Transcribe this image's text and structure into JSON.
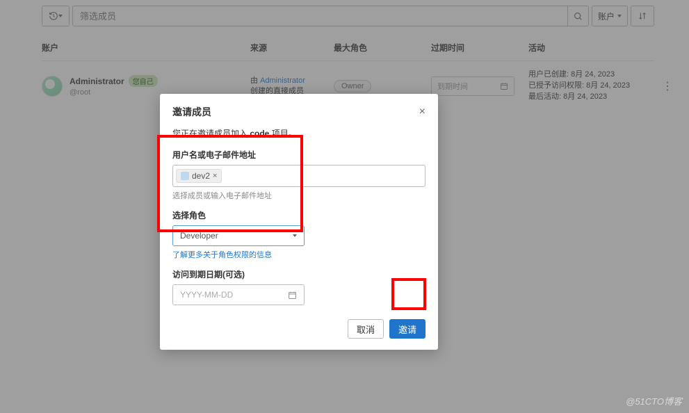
{
  "filter": {
    "search_placeholder": "筛选成员",
    "account_dd": "账户"
  },
  "table": {
    "headers": {
      "account": "账户",
      "source": "来源",
      "max_role": "最大角色",
      "expiry": "过期时间",
      "activity": "活动"
    },
    "row": {
      "name": "Administrator",
      "self_badge": "您自己",
      "handle": "@root",
      "source_prefix": "由 ",
      "source_link": "Administrator",
      "source_suffix": "创建的直接成员",
      "role": "Owner",
      "expiry_placeholder": "到期时间",
      "activity_line1": "用户已创建: 8月 24, 2023",
      "activity_line2": "已授予访问权限: 8月 24, 2023",
      "activity_line3": "最后活动: 8月 24, 2023"
    }
  },
  "modal": {
    "title": "邀请成员",
    "desc_prefix": "您正在邀请成员加入 ",
    "desc_project": "code",
    "desc_suffix": " 项目。",
    "user_label": "用户名或电子邮件地址",
    "chip_user": "dev2",
    "user_help": "选择成员或输入电子邮件地址",
    "role_label": "选择角色",
    "role_value": "Developer",
    "role_link": "了解更多关于角色权限的信息",
    "date_label": "访问到期日期(可选)",
    "date_placeholder": "YYYY-MM-DD",
    "cancel": "取消",
    "invite": "邀请"
  },
  "watermark": "@51CTO博客"
}
